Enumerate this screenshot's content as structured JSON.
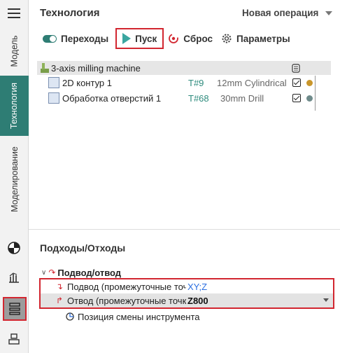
{
  "sidebar": {
    "tabs": [
      {
        "label": "Модель",
        "active": false
      },
      {
        "label": "Технология",
        "active": true
      },
      {
        "label": "Моделирование",
        "active": false
      }
    ],
    "icons": [
      "menu-icon",
      "sphere-icon",
      "chart-icon",
      "layers-icon",
      "stack-icon"
    ]
  },
  "header": {
    "title": "Технология",
    "new_operation": "Новая операция"
  },
  "toolbar": {
    "transitions": "Переходы",
    "run": "Пуск",
    "reset": "Сброс",
    "params": "Параметры"
  },
  "operations": {
    "machine": "3-axis milling machine",
    "rows": [
      {
        "name": "2D контур 1",
        "tool": "T#9",
        "desc": "12mm Cylindrical",
        "checked": true,
        "dot_color": "#c9962b"
      },
      {
        "name": "Обработка отверстий 1",
        "tool": "T#68",
        "desc": "30mm Drill",
        "checked": true,
        "dot_color": "#6f8b8b"
      }
    ]
  },
  "approach": {
    "title": "Подходы/Отходы",
    "group": "Подвод/отвод",
    "rows": [
      {
        "label": "Подвод (промежуточные точки)",
        "value": "XY;Z"
      },
      {
        "label": "Отвод (промежуточные точки)",
        "value": "Z800"
      }
    ],
    "tool_change": "Позиция смены инструмента"
  },
  "colors": {
    "accent": "#2e7d74",
    "highlight": "#d22630",
    "tool_text": "#2e8b7d",
    "link": "#2a6ee0"
  }
}
